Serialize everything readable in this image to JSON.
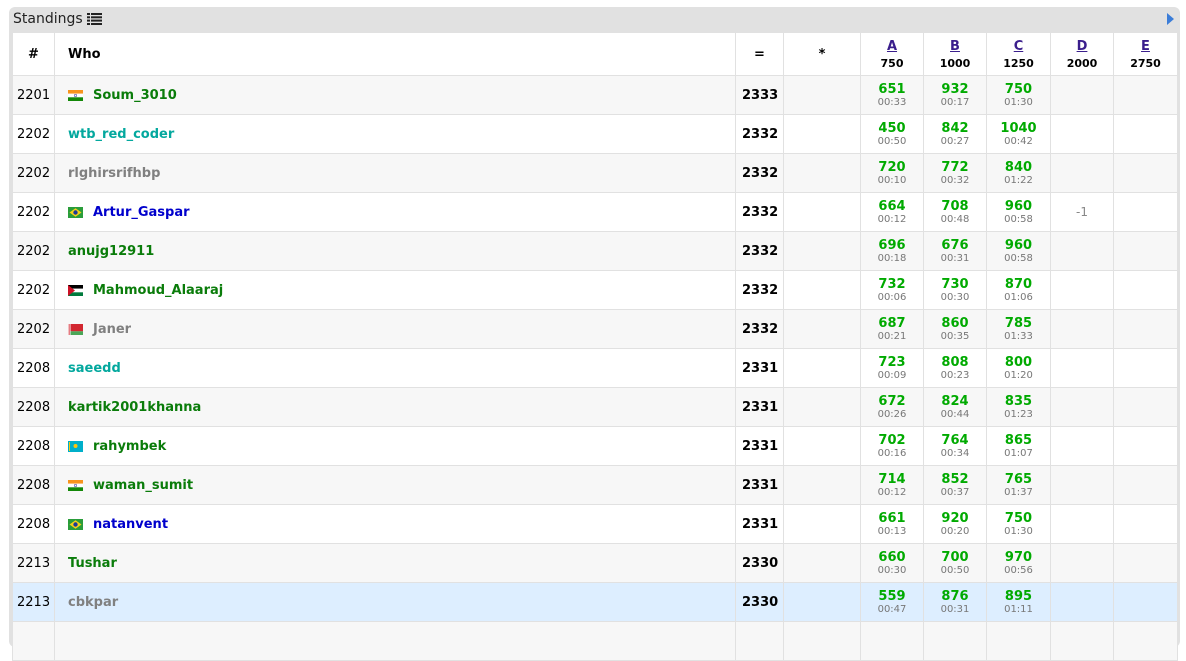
{
  "panel": {
    "title": "Standings"
  },
  "header": {
    "rank": "#",
    "who": "Who",
    "points": "=",
    "penalty": "*",
    "problems": [
      {
        "letter": "A",
        "points": "750"
      },
      {
        "letter": "B",
        "points": "1000"
      },
      {
        "letter": "C",
        "points": "1250"
      },
      {
        "letter": "D",
        "points": "2000"
      },
      {
        "letter": "E",
        "points": "2750"
      }
    ]
  },
  "colors": {
    "green_handle": "#0a7c0a",
    "teal_handle": "#03a89e",
    "blue_handle": "#0000cc",
    "gray_handle": "#808080",
    "accepted": "#00aa00"
  },
  "rows": [
    {
      "rank": "2201",
      "flag": "india",
      "handle": "Soum_3010",
      "color": "green",
      "points": "2333",
      "results": [
        {
          "score": "651",
          "time": "00:33"
        },
        {
          "score": "932",
          "time": "00:17"
        },
        {
          "score": "750",
          "time": "01:30"
        },
        {},
        {}
      ]
    },
    {
      "rank": "2202",
      "flag": "",
      "handle": "wtb_red_coder",
      "color": "teal",
      "points": "2332",
      "results": [
        {
          "score": "450",
          "time": "00:50"
        },
        {
          "score": "842",
          "time": "00:27"
        },
        {
          "score": "1040",
          "time": "00:42"
        },
        {},
        {}
      ]
    },
    {
      "rank": "2202",
      "flag": "",
      "handle": "rlghirsrifhbp",
      "color": "gray",
      "points": "2332",
      "results": [
        {
          "score": "720",
          "time": "00:10"
        },
        {
          "score": "772",
          "time": "00:32"
        },
        {
          "score": "840",
          "time": "01:22"
        },
        {},
        {}
      ]
    },
    {
      "rank": "2202",
      "flag": "brazil",
      "handle": "Artur_Gaspar",
      "color": "blue",
      "points": "2332",
      "results": [
        {
          "score": "664",
          "time": "00:12"
        },
        {
          "score": "708",
          "time": "00:48"
        },
        {
          "score": "960",
          "time": "00:58"
        },
        {
          "fail": "-1"
        },
        {}
      ]
    },
    {
      "rank": "2202",
      "flag": "",
      "handle": "anujg12911",
      "color": "green",
      "points": "2332",
      "results": [
        {
          "score": "696",
          "time": "00:18"
        },
        {
          "score": "676",
          "time": "00:31"
        },
        {
          "score": "960",
          "time": "00:58"
        },
        {},
        {}
      ]
    },
    {
      "rank": "2202",
      "flag": "jordan",
      "handle": "Mahmoud_Alaaraj",
      "color": "green",
      "points": "2332",
      "results": [
        {
          "score": "732",
          "time": "00:06"
        },
        {
          "score": "730",
          "time": "00:30"
        },
        {
          "score": "870",
          "time": "01:06"
        },
        {},
        {}
      ]
    },
    {
      "rank": "2202",
      "flag": "belarus",
      "handle": "Janer",
      "color": "gray",
      "points": "2332",
      "results": [
        {
          "score": "687",
          "time": "00:21"
        },
        {
          "score": "860",
          "time": "00:35"
        },
        {
          "score": "785",
          "time": "01:33"
        },
        {},
        {}
      ]
    },
    {
      "rank": "2208",
      "flag": "",
      "handle": "saeedd",
      "color": "teal",
      "points": "2331",
      "results": [
        {
          "score": "723",
          "time": "00:09"
        },
        {
          "score": "808",
          "time": "00:23"
        },
        {
          "score": "800",
          "time": "01:20"
        },
        {},
        {}
      ]
    },
    {
      "rank": "2208",
      "flag": "",
      "handle": "kartik2001khanna",
      "color": "green",
      "points": "2331",
      "results": [
        {
          "score": "672",
          "time": "00:26"
        },
        {
          "score": "824",
          "time": "00:44"
        },
        {
          "score": "835",
          "time": "01:23"
        },
        {},
        {}
      ]
    },
    {
      "rank": "2208",
      "flag": "kazakhstan",
      "handle": "rahymbek",
      "color": "green",
      "points": "2331",
      "results": [
        {
          "score": "702",
          "time": "00:16"
        },
        {
          "score": "764",
          "time": "00:34"
        },
        {
          "score": "865",
          "time": "01:07"
        },
        {},
        {}
      ]
    },
    {
      "rank": "2208",
      "flag": "india",
      "handle": "waman_sumit",
      "color": "green",
      "points": "2331",
      "results": [
        {
          "score": "714",
          "time": "00:12"
        },
        {
          "score": "852",
          "time": "00:37"
        },
        {
          "score": "765",
          "time": "01:37"
        },
        {},
        {}
      ]
    },
    {
      "rank": "2208",
      "flag": "brazil",
      "handle": "natanvent",
      "color": "blue",
      "points": "2331",
      "results": [
        {
          "score": "661",
          "time": "00:13"
        },
        {
          "score": "920",
          "time": "00:20"
        },
        {
          "score": "750",
          "time": "01:30"
        },
        {},
        {}
      ]
    },
    {
      "rank": "2213",
      "flag": "",
      "handle": "Tushar",
      "color": "green",
      "points": "2330",
      "results": [
        {
          "score": "660",
          "time": "00:30"
        },
        {
          "score": "700",
          "time": "00:50"
        },
        {
          "score": "970",
          "time": "00:56"
        },
        {},
        {}
      ]
    },
    {
      "rank": "2213",
      "flag": "",
      "handle": "cbkpar",
      "color": "gray",
      "points": "2330",
      "highlight": true,
      "results": [
        {
          "score": "559",
          "time": "00:47"
        },
        {
          "score": "876",
          "time": "00:31"
        },
        {
          "score": "895",
          "time": "01:11"
        },
        {},
        {}
      ]
    },
    {
      "rank": "",
      "flag": "",
      "handle": "",
      "color": "gray",
      "points": "",
      "results": [
        {},
        {},
        {},
        {},
        {}
      ]
    }
  ]
}
